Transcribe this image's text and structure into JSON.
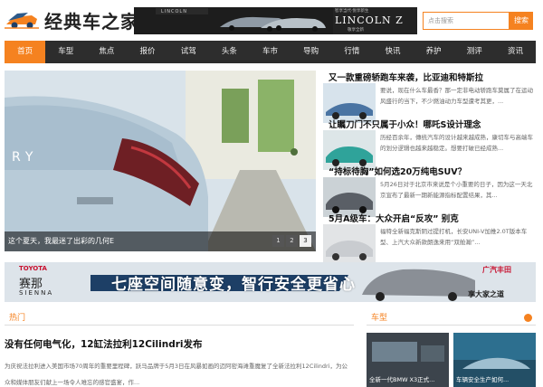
{
  "site": {
    "name": "经典车之家"
  },
  "top_banner": {
    "brand_left": "LINCOLN",
    "brand_right": "LINCOLN Z",
    "tagline": "智享当代·悦享新生",
    "sub": "敬享全新"
  },
  "search": {
    "placeholder": "点击搜索",
    "button": "搜索"
  },
  "nav": {
    "items": [
      "首页",
      "车型",
      "焦点",
      "报价",
      "试驾",
      "头条",
      "车市",
      "导购",
      "行情",
      "快讯",
      "养护",
      "测评",
      "资讯"
    ],
    "active_index": 0
  },
  "slider": {
    "caption": "这个夏天，我最迷了出彩的几何E",
    "pages": [
      "1",
      "2",
      "3"
    ],
    "active_page": "3",
    "badge": "RY"
  },
  "news": [
    {
      "title": "又一款重磅轿跑车来袭，比亚迪和特斯拉",
      "desc": "要说，现在什么车最香？那一定非电动轿跑车莫属了在运动风盛行的当下，不少燃油动力车型遭考其更，..."
    },
    {
      "title": "让瞩刀门不只属于小众！哪吒S设计理念",
      "desc": "历经百余年，傳统汽车的设计越来越成熟，康切车与高端车的划分逻辑也越来越稳定。想要打破已经成熟..."
    },
    {
      "title": "“持标待胸”如何选20万纯电SUV？",
      "desc": "5月26日对于北京市来说是个小重要的日子，因为这一天北京宣布了最新一期新能源指标配置结果，其..."
    },
    {
      "title": "5月A级车：大众开启“反攻” 别克",
      "desc": "福特全新福克斯阴过提打机，长安UNI-V加推2.0T版本车型、上汽大众新款朗逸来用“双舱瀚”..."
    }
  ],
  "ad": {
    "brand": "TOYOTA",
    "model_cn": "赛那",
    "model_en": "SIENNA",
    "slogan": "七座空间随意变，智行安全更省心",
    "dealer": "广汽丰田",
    "promo": "享大家之道"
  },
  "hot": {
    "section_title": "热门",
    "headline": "没有任何电气化，12缸法拉利12Cilindri发布",
    "desc": "为庆祝法拉利进入美国市场70周年的重要里程碑，跃马品牌于5月3日在风暴如画的迈阿密海滩重魔复了全新法拉利12Cilindri，为公众和媒体朋友们献上一场令人难忘的感官盛宴，作..."
  },
  "models": {
    "section_title": "车型",
    "captions": [
      "全新一代BMW X3正式...",
      "车辆安全生产如何..."
    ]
  },
  "colors": {
    "accent": "#f58220",
    "nav_bg": "#2d2d2d"
  }
}
